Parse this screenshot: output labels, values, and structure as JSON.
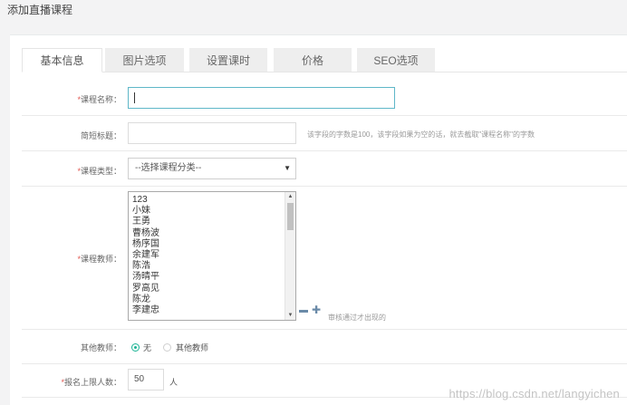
{
  "page": {
    "title": "添加直播课程"
  },
  "tabs": [
    {
      "label": "基本信息",
      "active": true
    },
    {
      "label": "图片选项",
      "active": false
    },
    {
      "label": "设置课时",
      "active": false
    },
    {
      "label": "价格",
      "active": false
    },
    {
      "label": "SEO选项",
      "active": false
    }
  ],
  "form": {
    "course_name": {
      "required_mark": "*",
      "label": "课程名称：",
      "value": ""
    },
    "short_title": {
      "label": "简短标题：",
      "value": "",
      "hint": "该字段的字数是100，该字段如果为空的话，就去截取\"课程名称\"的字数"
    },
    "course_type": {
      "required_mark": "*",
      "label": "课程类型：",
      "selected": "--选择课程分类--"
    },
    "teacher": {
      "required_mark": "*",
      "label": "课程教师：",
      "options": [
        "123",
        "小妹",
        "王勇",
        "曹杨波",
        "杨序国",
        "余建军",
        "陈浩",
        "汤晴平",
        "罗高见",
        "陈龙",
        "李建忠"
      ],
      "note": "审核通过才出现的"
    },
    "other_teacher": {
      "label": "其他教师：",
      "options": [
        "无",
        "其他教师"
      ],
      "selected": "无"
    },
    "limit": {
      "required_mark": "*",
      "label": "报名上限人数：",
      "value": "50",
      "unit": "人"
    }
  },
  "watermark": "https://blog.csdn.net/langyichen",
  "colors": {
    "accent": "#1ab394",
    "required": "#e0554f",
    "focus_border": "#5fb7c8"
  }
}
